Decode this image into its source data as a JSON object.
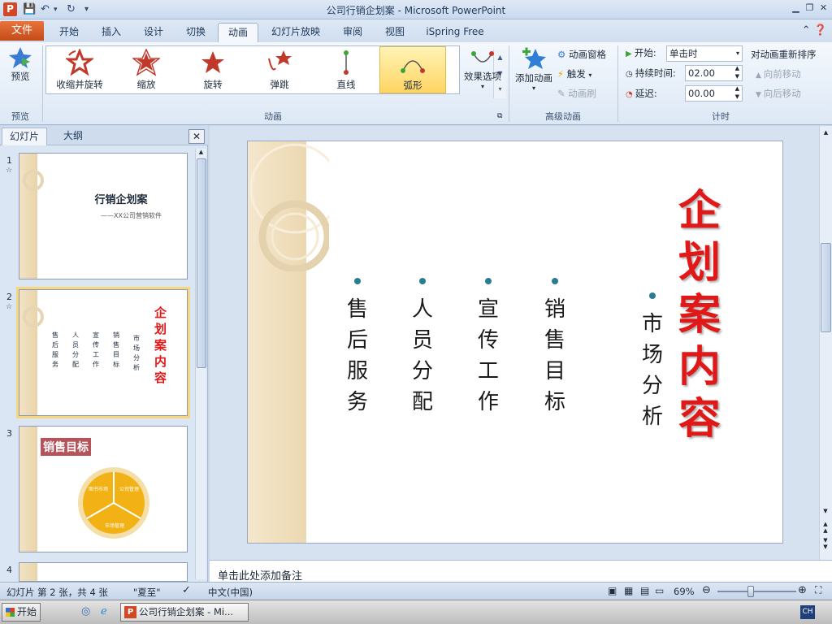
{
  "app": {
    "logo_letter": "P",
    "window_title": "公司行销企划案 - Microsoft PowerPoint"
  },
  "tabs": {
    "file": "文件",
    "items": [
      "开始",
      "插入",
      "设计",
      "切换",
      "动画",
      "幻灯片放映",
      "审阅",
      "视图",
      "iSpring Free"
    ],
    "active": "动画"
  },
  "ribbon": {
    "preview": {
      "button": "预览",
      "group": "预览"
    },
    "animation_group": "动画",
    "animations": [
      "收缩并旋转",
      "缩放",
      "旋转",
      "弹跳",
      "直线",
      "弧形"
    ],
    "selected_animation": "弧形",
    "effect_options": "效果选项",
    "advanced": {
      "group": "高级动画",
      "add_animation": "添加动画",
      "animation_pane": "动画窗格",
      "trigger": "触发",
      "animation_painter": "动画刷"
    },
    "timing": {
      "group": "计时",
      "start_label": "开始:",
      "start_value": "单击时",
      "duration_label": "持续时间:",
      "duration_value": "02.00",
      "delay_label": "延迟:",
      "delay_value": "00.00",
      "reorder_title": "对动画重新排序",
      "move_earlier": "向前移动",
      "move_later": "向后移动"
    }
  },
  "left_panel": {
    "tabs": [
      "幻灯片",
      "大纲"
    ],
    "close": "✕",
    "slides": [
      {
        "num": "1",
        "title": "行销企划案",
        "subtitle": "——XX公司营销软件"
      },
      {
        "num": "2",
        "title": "企划案内容",
        "columns": [
          "售后服务",
          "人员分配",
          "宣传工作",
          "销售目标",
          "市场分析"
        ]
      },
      {
        "num": "3",
        "title": "销售目标",
        "segments": [
          "图书市场",
          "公司管理",
          "市场管理"
        ]
      },
      {
        "num": "4"
      }
    ]
  },
  "slide": {
    "title": "企划案内容",
    "columns": [
      "售后服务",
      "人员分配",
      "宣传工作",
      "销售目标",
      "市场分析"
    ]
  },
  "notes": {
    "placeholder": "单击此处添加备注"
  },
  "status": {
    "slide_info": "幻灯片 第 2 张，共 4 张",
    "theme": "\"夏至\"",
    "language": "中文(中国)",
    "zoom": "69%",
    "zoom_fraction": 0.42
  },
  "taskbar": {
    "start": "开始",
    "app_button": "公司行销企划案 - Mi...",
    "ime": "CH"
  },
  "colors": {
    "accent_file_tab": "#d24726",
    "slide_title": "#e01818",
    "bullet_dot": "#2b7c93",
    "selected_animation": "#ffd563"
  }
}
